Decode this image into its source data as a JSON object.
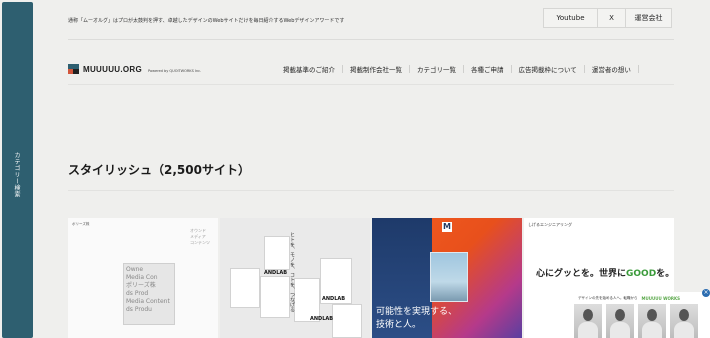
{
  "sidebar": {
    "label": "カテゴリー検索"
  },
  "header": {
    "tagline": "通称「ムーオルグ」はプロが太鼓判を押す、卓越したデザインのWebサイトだけを毎日紹介するWebデザインアワードです",
    "buttons": {
      "youtube": "Youtube",
      "x": "X",
      "company": "運営会社"
    }
  },
  "logo": {
    "text": "MUUUUU.ORG",
    "powered": "Powered by QUOITWORKS Inc."
  },
  "nav": {
    "items": [
      "掲載基準のご紹介",
      "掲載制作会社一覧",
      "カテゴリ一覧",
      "各種ご申請",
      "広告掲載枠について",
      "運営者の想い"
    ]
  },
  "section": {
    "title": "スタイリッシュ（2,500サイト）"
  },
  "thumbnails": [
    {
      "name": "ポリーズ株",
      "cube_text": "Owne\nMedia Con\nポリーズ株\nds Prod\nMedia Content\nds Produ",
      "side_words": [
        "オウンド",
        "メディア",
        "コンテンツ"
      ]
    },
    {
      "label": "ANDLAB",
      "vertical_text": "ヒトを、モノを、コトを、つなげる"
    },
    {
      "logo": "M",
      "copy_line1": "可能性を実現する、",
      "copy_line2": "技術と人。"
    },
    {
      "header": "しげるエンジニアリング",
      "headline_pre": "心にグッとを。世界に",
      "headline_good": "GOOD",
      "headline_post": "を。"
    }
  ],
  "ad": {
    "close": "×",
    "copy": "デザインの先を始める人へ。転職から",
    "brand": "MUUUUU WORKS"
  }
}
